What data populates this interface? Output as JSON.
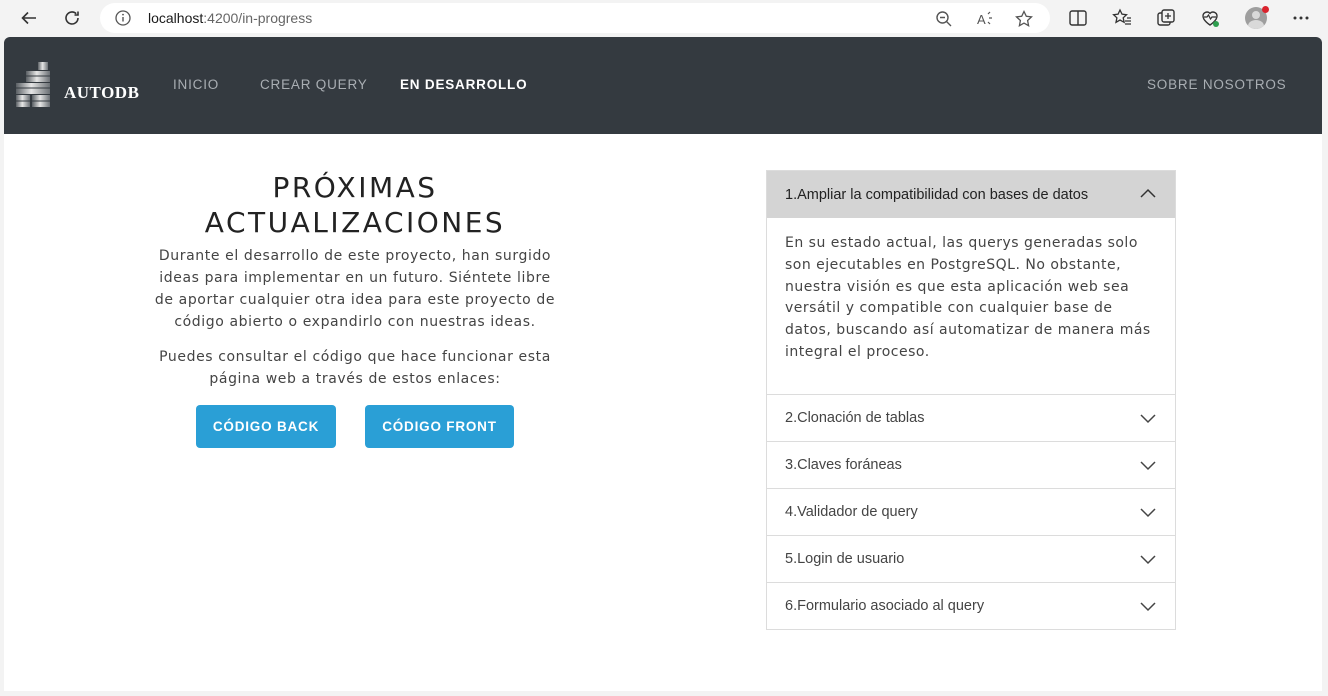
{
  "browser": {
    "url_host": "localhost",
    "url_path": ":4200/in-progress"
  },
  "navbar": {
    "brand": "AUTODB",
    "links": [
      {
        "label": "INICIO",
        "active": false
      },
      {
        "label": "CREAR QUERY",
        "active": false
      },
      {
        "label": "EN DESARROLLO",
        "active": true
      },
      {
        "label": "SOBRE NOSOTROS",
        "active": false
      }
    ]
  },
  "main": {
    "title_line1": "PRÓXIMAS",
    "title_line2": "ACTUALIZACIONES",
    "intro": "Durante el desarrollo de este proyecto, han surgido ideas para implementar en un futuro. Siéntete libre de aportar cualquier otra idea para este proyecto de código abierto o expandirlo con nuestras ideas.",
    "links_text": "Puedes consultar el código que hace funcionar esta página web a través de estos enlaces:",
    "button_back": "CÓDIGO BACK",
    "button_front": "CÓDIGO FRONT"
  },
  "accordion": {
    "items": [
      {
        "label": "1.Ampliar la compatibilidad con bases de datos",
        "open": true,
        "body": "En su estado actual, las querys generadas solo son ejecutables en PostgreSQL. No obstante, nuestra visión es que esta aplicación web sea versátil y compatible con cualquier base de datos, buscando así automatizar de manera más integral el proceso."
      },
      {
        "label": "2.Clonación de tablas",
        "open": false
      },
      {
        "label": "3.Claves foráneas",
        "open": false
      },
      {
        "label": "4.Validador de query",
        "open": false
      },
      {
        "label": "5.Login de usuario",
        "open": false
      },
      {
        "label": "6.Formulario asociado al query",
        "open": false
      }
    ]
  },
  "colors": {
    "navbar_bg": "#343a40",
    "button_bg": "#2a9fd6",
    "accordion_open_bg": "#d4d4d4"
  }
}
